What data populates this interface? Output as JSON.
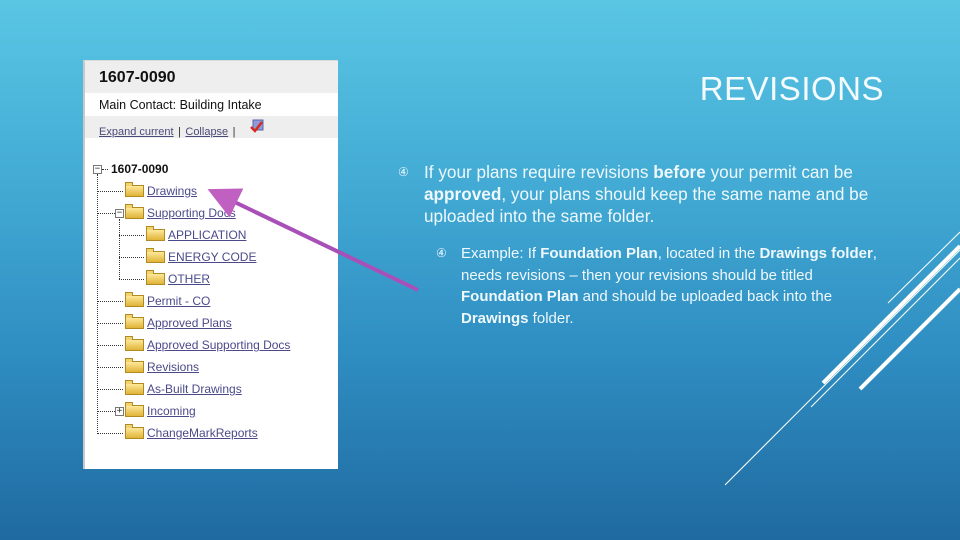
{
  "slide": {
    "title": "REVISIONS",
    "bullets": [
      {
        "marker": "④",
        "parts": [
          "If your plans require revisions ",
          "before",
          " your permit can be ",
          "approved",
          ", your plans should keep the same name and be uploaded into the same folder."
        ]
      },
      {
        "marker": "④",
        "parts": [
          "Example: If ",
          "Foundation Plan",
          ", located in the ",
          "Drawings folder",
          ", needs revisions – then your revisions should be titled ",
          "Foundation Plan",
          " and should be uploaded back into the ",
          "Drawings",
          " folder."
        ]
      }
    ],
    "colors": {
      "background_top": "#5ac6e4",
      "background_bottom": "#1f6aa0",
      "arrow": "#a94fb8",
      "text": "#eef8fd"
    }
  },
  "screenshot": {
    "header_title": "1607-0090",
    "contact": "Main Contact: Building Intake",
    "expand_label": "Expand current",
    "collapse_label": "Collapse",
    "separator": "|",
    "tree": {
      "root": "1607-0090",
      "items": [
        {
          "label": "Drawings",
          "level": 1
        },
        {
          "label": "Supporting Docs",
          "level": 1,
          "expanded": true
        },
        {
          "label": "APPLICATION",
          "level": 2
        },
        {
          "label": "ENERGY CODE",
          "level": 2
        },
        {
          "label": "OTHER",
          "level": 2
        },
        {
          "label": "Permit - CO",
          "level": 1
        },
        {
          "label": "Approved Plans",
          "level": 1
        },
        {
          "label": "Approved Supporting Docs",
          "level": 1
        },
        {
          "label": "Revisions",
          "level": 1
        },
        {
          "label": "As-Built Drawings",
          "level": 1
        },
        {
          "label": "Incoming",
          "level": 1,
          "collapsed": true
        },
        {
          "label": "ChangeMarkReports",
          "level": 1
        }
      ]
    },
    "expand_symbol_minus": "−",
    "expand_symbol_plus": "+"
  }
}
